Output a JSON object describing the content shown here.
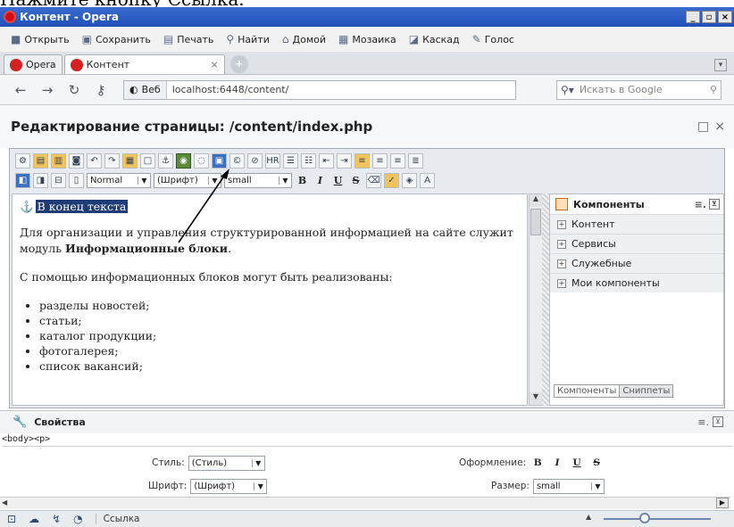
{
  "caption": "Нажмите кнопку Ссылка.",
  "window": {
    "title": "Контент - Opera",
    "buttons": [
      "_",
      "▫",
      "×"
    ]
  },
  "menubar": [
    {
      "label": "Открыть",
      "icon": "folder-icon"
    },
    {
      "label": "Сохранить",
      "icon": "save-icon"
    },
    {
      "label": "Печать",
      "icon": "print-icon"
    },
    {
      "label": "Найти",
      "icon": "search-icon"
    },
    {
      "label": "Домой",
      "icon": "home-icon"
    },
    {
      "label": "Мозаика",
      "icon": "tile-icon"
    },
    {
      "label": "Каскад",
      "icon": "cascade-icon"
    },
    {
      "label": "Голос",
      "icon": "voice-icon"
    }
  ],
  "tabs": {
    "menu_label": "Opera",
    "active_label": "Контент"
  },
  "address": {
    "web_label": "Веб",
    "url": "localhost:6448/content/",
    "search_placeholder": "Искать в Google"
  },
  "page_header": {
    "title": "Редактирование страницы: /content/index.php"
  },
  "toolbar": {
    "paragraph_style": "Normal",
    "font": "(Шрифт)",
    "size": "small",
    "format_buttons": [
      "B",
      "I",
      "U",
      "S"
    ]
  },
  "editor": {
    "anchor_text": "В конец текста",
    "para1_start": "Для организации и управления структурированной информацией на сайте служит модуль ",
    "para1_bold": "Информационные блоки",
    "para1_end": ".",
    "para2": "С помощью информационных блоков могут быть реализованы:",
    "list": [
      "разделы новостей;",
      "статьи;",
      "каталог продукции;",
      "фотогалерея;",
      "список вакансий;"
    ]
  },
  "components": {
    "title": "Компоненты",
    "items": [
      "Контент",
      "Сервисы",
      "Служебные",
      "Мои компоненты"
    ],
    "tabs": [
      "Компоненты",
      "Сниппеты"
    ]
  },
  "properties": {
    "title": "Свойства",
    "breadcrumb": "<body><p>",
    "style_label": "Стиль:",
    "style_value": "(Стиль)",
    "font_label": "Шрифт:",
    "font_value": "(Шрифт)",
    "format_label": "Оформление:",
    "size_label": "Размер:",
    "size_value": "small"
  },
  "statusbar": {
    "text": "Ссылка"
  }
}
